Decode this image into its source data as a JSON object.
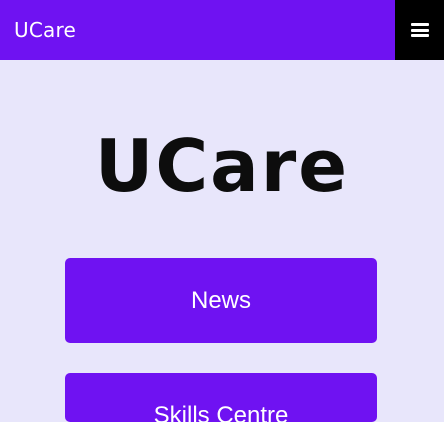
{
  "app": {
    "title": "UCare",
    "menu_icon": "menu-icon"
  },
  "logo": {
    "text": "UCare"
  },
  "buttons": {
    "news": "News",
    "skills_centre": "Skills Centre"
  },
  "colors": {
    "header_purple": "#6f12f2",
    "menu_black": "#000000",
    "background": "#e8e6fb",
    "text_white": "#ffffff",
    "logo_black": "#0d0d0d"
  }
}
